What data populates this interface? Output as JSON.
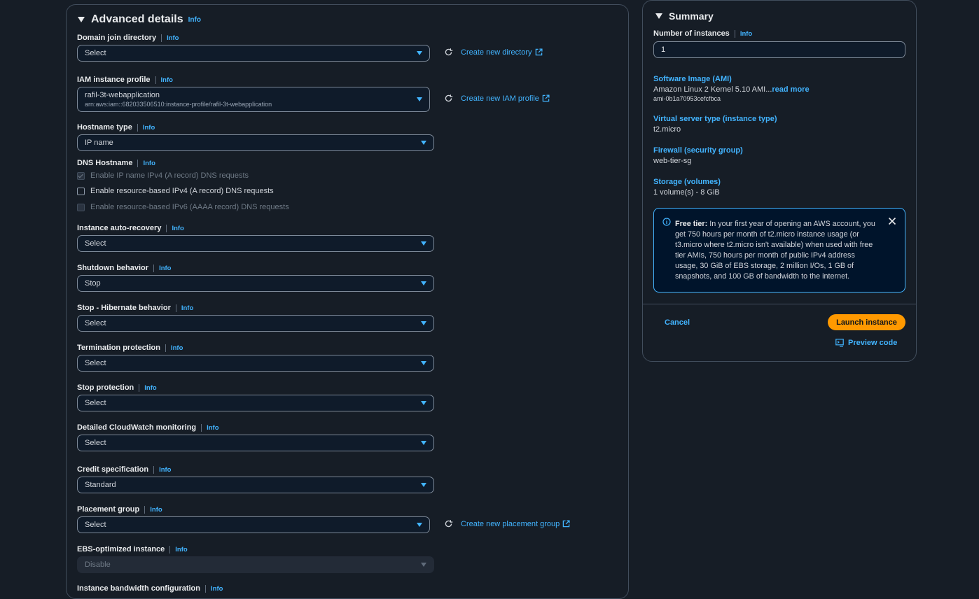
{
  "advanced": {
    "title": "Advanced details",
    "info": "Info",
    "domain_join": {
      "label": "Domain join directory",
      "value": "Select",
      "link": "Create new directory"
    },
    "iam_profile": {
      "label": "IAM instance profile",
      "value": "rafil-3t-webapplication",
      "arn": "arn:aws:iam::682033506510:instance-profile/rafil-3t-webapplication",
      "link": "Create new IAM profile"
    },
    "hostname_type": {
      "label": "Hostname type",
      "value": "IP name"
    },
    "dns_hostname": {
      "label": "DNS Hostname",
      "options": [
        "Enable IP name IPv4 (A record) DNS requests",
        "Enable resource-based IPv4 (A record) DNS requests",
        "Enable resource-based IPv6 (AAAA record) DNS requests"
      ]
    },
    "auto_recovery": {
      "label": "Instance auto-recovery",
      "value": "Select"
    },
    "shutdown": {
      "label": "Shutdown behavior",
      "value": "Stop"
    },
    "hibernate": {
      "label": "Stop - Hibernate behavior",
      "value": "Select"
    },
    "termination": {
      "label": "Termination protection",
      "value": "Select"
    },
    "stop_protection": {
      "label": "Stop protection",
      "value": "Select"
    },
    "cloudwatch": {
      "label": "Detailed CloudWatch monitoring",
      "value": "Select"
    },
    "credit": {
      "label": "Credit specification",
      "value": "Standard"
    },
    "placement": {
      "label": "Placement group",
      "value": "Select",
      "link": "Create new placement group"
    },
    "ebs": {
      "label": "EBS-optimized instance",
      "value": "Disable"
    },
    "bandwidth": {
      "label": "Instance bandwidth configuration"
    }
  },
  "summary": {
    "title": "Summary",
    "instances_label": "Number of instances",
    "info": "Info",
    "instances_value": "1",
    "ami": {
      "key": "Software Image (AMI)",
      "value": "Amazon Linux 2 Kernel 5.10 AMI...",
      "read_more": "read more",
      "id": "ami-0b1a70953cefcfbca"
    },
    "instance_type": {
      "key": "Virtual server type (instance type)",
      "value": "t2.micro"
    },
    "firewall": {
      "key": "Firewall (security group)",
      "value": "web-tier-sg"
    },
    "storage": {
      "key": "Storage (volumes)",
      "value": "1 volume(s) - 8 GiB"
    },
    "free_tier": {
      "title": "Free tier:",
      "text": "In your first year of opening an AWS account, you get 750 hours per month of t2.micro instance usage (or t3.micro where t2.micro isn't available) when used with free tier AMIs, 750 hours per month of public IPv4 address usage, 30 GiB of EBS storage, 2 million I/Os, 1 GB of snapshots, and 100 GB of bandwidth to the internet."
    },
    "cancel": "Cancel",
    "launch": "Launch instance",
    "preview": "Preview code"
  },
  "colors": {
    "accent": "#42b4ff",
    "launch": "#ff9900",
    "background": "#161d26",
    "border": "#414d5c"
  }
}
